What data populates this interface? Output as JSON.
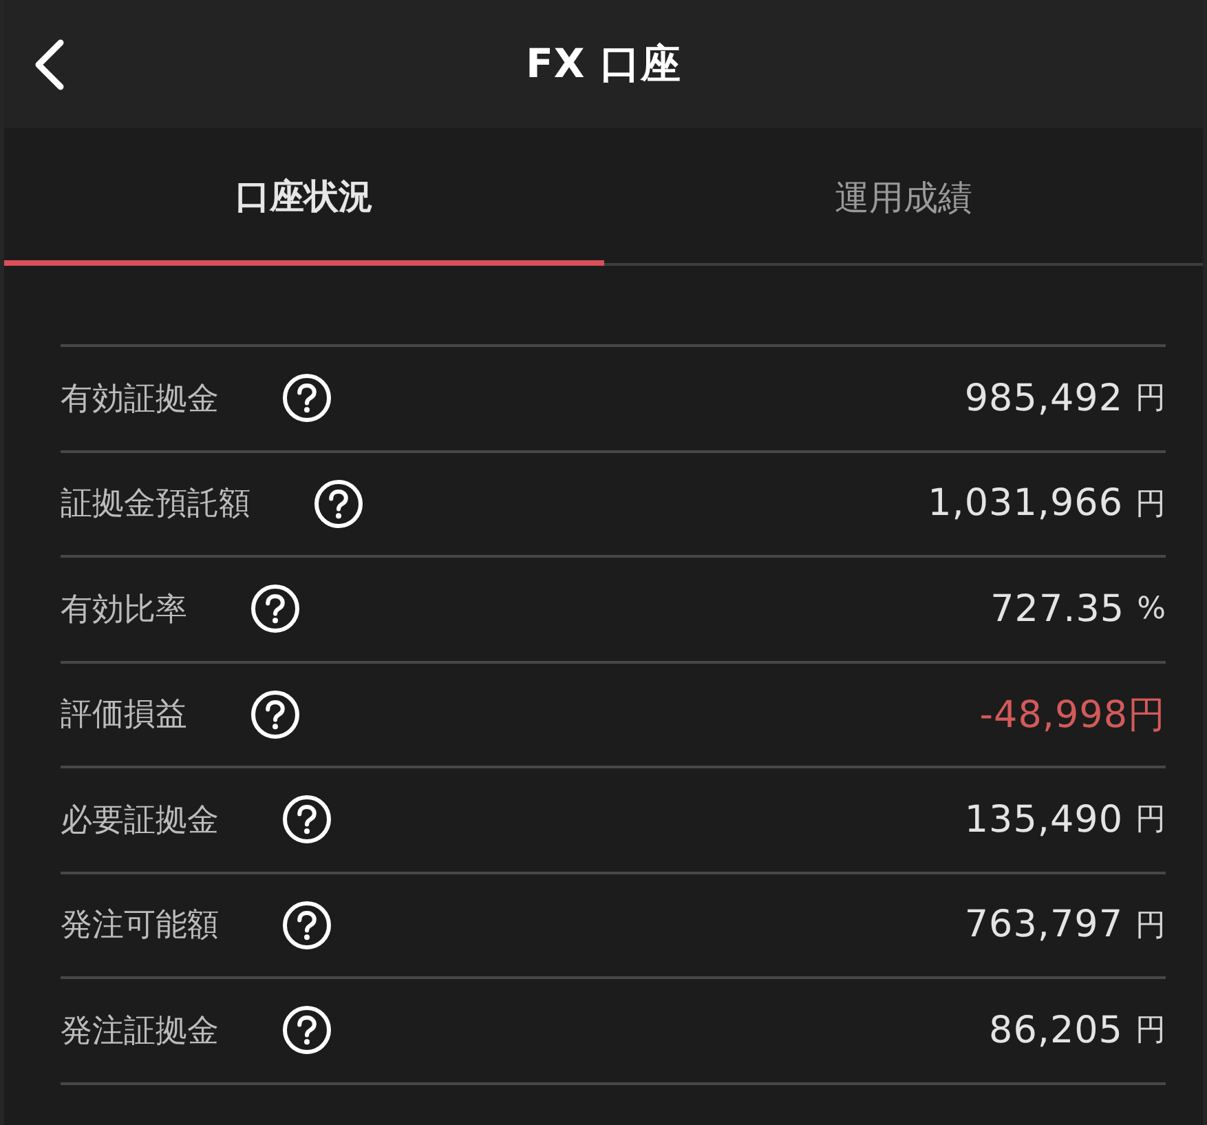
{
  "header": {
    "title": "FX 口座"
  },
  "tabs": [
    {
      "label": "口座状況",
      "selected": true
    },
    {
      "label": "運用成績",
      "selected": false
    }
  ],
  "rows": [
    {
      "label": "有効証拠金",
      "value": "985,492",
      "unit": "円",
      "negative": false
    },
    {
      "label": "証拠金預託額",
      "value": "1,031,966",
      "unit": "円",
      "negative": false
    },
    {
      "label": "有効比率",
      "value": "727.35",
      "unit": "%",
      "negative": false
    },
    {
      "label": "評価損益",
      "value": "-48,998円",
      "negative": true
    },
    {
      "label": "必要証拠金",
      "value": "135,490",
      "unit": "円",
      "negative": false
    },
    {
      "label": "発注可能額",
      "value": "763,797",
      "unit": "円",
      "negative": false
    },
    {
      "label": "発注証拠金",
      "value": "86,205",
      "unit": "円",
      "negative": false
    }
  ]
}
